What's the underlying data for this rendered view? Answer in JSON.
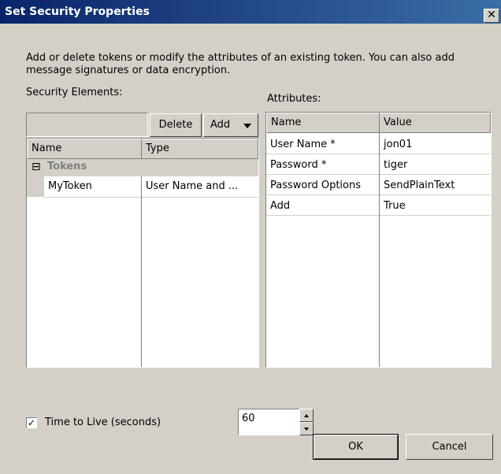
{
  "window": {
    "title": "Set Security Properties",
    "close_glyph": "✕"
  },
  "description": "Add or delete tokens or modify the attributes of an existing token. You can also add message signatures or data encryption.",
  "security_elements": {
    "label": "Security Elements:",
    "delete_label": "Delete",
    "add_label": "Add",
    "columns": [
      "Name",
      "Type"
    ],
    "group": {
      "toggle": "⊟",
      "label": "Tokens"
    },
    "rows": [
      {
        "name": "MyToken",
        "type": "User Name and ..."
      }
    ]
  },
  "attributes": {
    "label": "Attributes:",
    "columns": [
      "Name",
      "Value"
    ],
    "rows": [
      {
        "name": "User Name *",
        "value": "jon01"
      },
      {
        "name": "Password *",
        "value": "tiger"
      },
      {
        "name": "Password Options",
        "value": "SendPlainText"
      },
      {
        "name": "Add",
        "value": "True"
      }
    ]
  },
  "ttl": {
    "checked": true,
    "check_glyph": "✓",
    "label": "Time to Live (seconds)",
    "value": "60"
  },
  "buttons": {
    "ok": "OK",
    "cancel": "Cancel"
  },
  "icons": {
    "dropdown": "chevron-down-icon",
    "spin_up": "spin-up-icon",
    "spin_down": "spin-down-icon"
  }
}
